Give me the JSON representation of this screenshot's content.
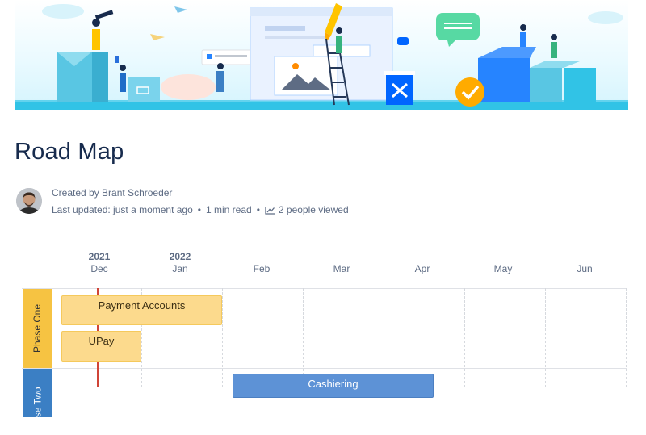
{
  "page": {
    "title": "Road Map",
    "author_prefix": "Created by",
    "author": "Brant Schroeder",
    "last_updated": "Last updated: just a moment ago",
    "read_time": "1 min read",
    "viewers": "2 people viewed"
  },
  "roadmap": {
    "months": [
      {
        "year": "2021",
        "label": "Dec"
      },
      {
        "year": "2022",
        "label": "Jan"
      },
      {
        "year": "",
        "label": "Feb"
      },
      {
        "year": "",
        "label": "Mar"
      },
      {
        "year": "",
        "label": "Apr"
      },
      {
        "year": "",
        "label": "May"
      },
      {
        "year": "",
        "label": "Jun"
      }
    ],
    "lanes": [
      {
        "name": "Phase One",
        "color": "#f6c342"
      },
      {
        "name": "Phase Two",
        "color": "#3b7fc4"
      }
    ],
    "bars": [
      {
        "label": "Payment Accounts",
        "lane": "Phase One",
        "color": "#fcda8d"
      },
      {
        "label": "UPay",
        "lane": "Phase One",
        "color": "#fcda8d"
      },
      {
        "label": "Cashiering",
        "lane": "Phase Two",
        "color": "#5d92d6"
      }
    ],
    "today_marker_color": "#d04437"
  },
  "banner": {
    "accent": "#00b8d9",
    "chat_bubble_color": "#57d9a3",
    "check_badge_color": "#ffab00"
  }
}
